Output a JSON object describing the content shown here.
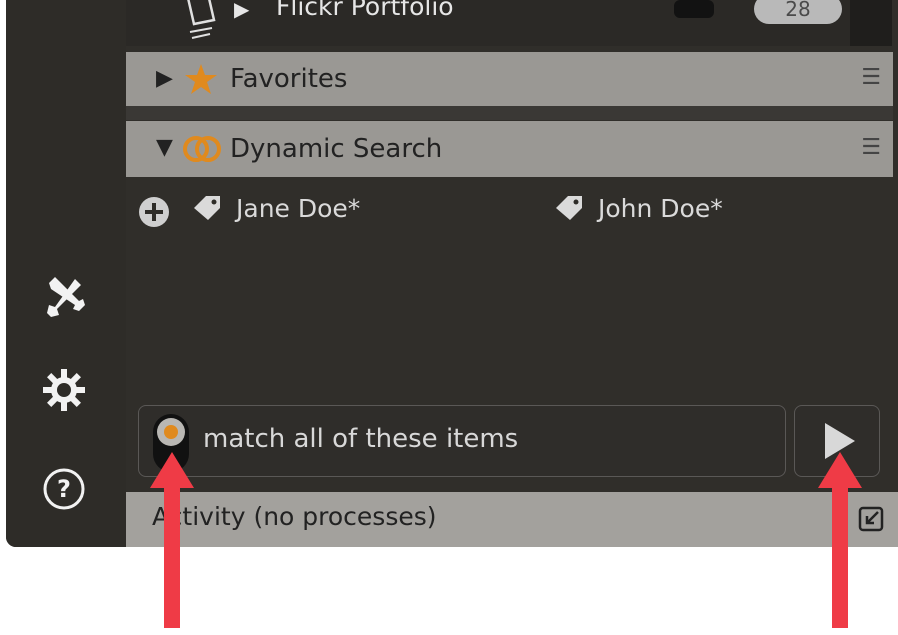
{
  "top_row": {
    "label": "Flickr Portfolio",
    "count": "28"
  },
  "favorites": {
    "title": "Favorites"
  },
  "dynamic_search": {
    "title": "Dynamic Search",
    "tags": [
      {
        "label": "Jane Doe*"
      },
      {
        "label": "John Doe*"
      }
    ]
  },
  "match": {
    "text": "match all of these items"
  },
  "activity": {
    "label": "Activity (no processes)"
  },
  "colors": {
    "accent_orange": "#e08a1e",
    "annotation_red": "#ef3b46",
    "panel_dark": "#302e2a",
    "header_gray": "#9a9894"
  }
}
